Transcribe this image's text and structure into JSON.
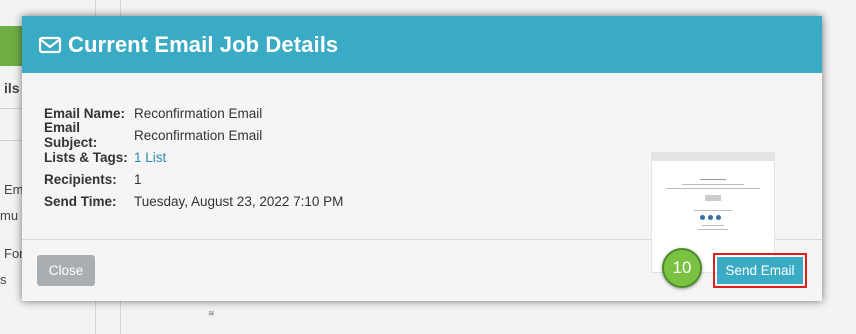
{
  "background": {
    "frag_1": "ils",
    "frag_2": "Em",
    "frag_3": "mu",
    "frag_4": "For",
    "frag_5": "s"
  },
  "modal": {
    "title": "Current Email Job Details",
    "title_icon": "envelope-icon",
    "fields": [
      {
        "label": "Email Name:",
        "value": "Reconfirmation Email"
      },
      {
        "label": "Email Subject:",
        "value": "Reconfirmation Email"
      },
      {
        "label": "Lists & Tags:",
        "value": "1 List"
      },
      {
        "label": "Recipients:",
        "value": "1"
      },
      {
        "label": "Send Time:",
        "value": "Tuesday, August 23, 2022 7:10 PM"
      }
    ]
  },
  "footer": {
    "close_label": "Close",
    "send_label": "Send Email",
    "step_badge": "10"
  },
  "colors": {
    "header": "#3aabc4",
    "badge": "#7cc242",
    "highlight": "#e01d1d"
  }
}
